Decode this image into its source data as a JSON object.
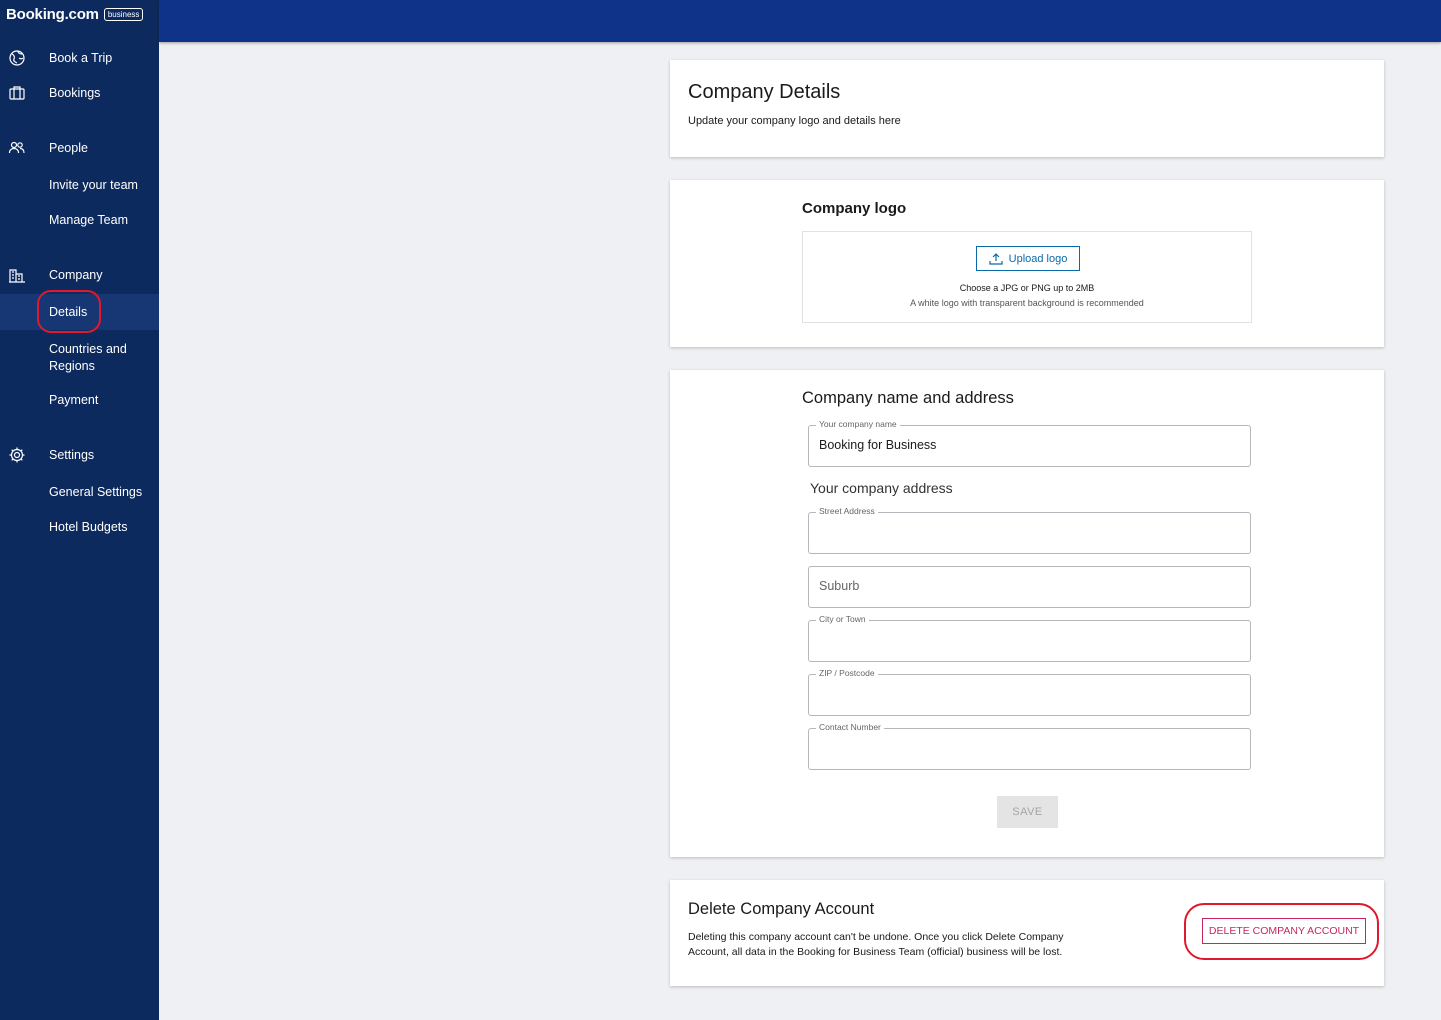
{
  "brand": {
    "name": "Booking.com",
    "badge": "business"
  },
  "sidebar": {
    "book_trip": "Book a Trip",
    "bookings": "Bookings",
    "people": "People",
    "invite_team": "Invite your team",
    "manage_team": "Manage Team",
    "company": "Company",
    "details": "Details",
    "countries_regions_line1": "Countries and",
    "countries_regions_line2": "Regions",
    "payment": "Payment",
    "settings": "Settings",
    "general_settings": "General Settings",
    "hotel_budgets": "Hotel Budgets"
  },
  "header_card": {
    "title": "Company Details",
    "subtitle": "Update your company logo and details here"
  },
  "logo_card": {
    "title": "Company logo",
    "upload_label": "Upload logo",
    "hint_formats": "Choose a JPG or PNG up to 2MB",
    "hint_recommendation": "A white logo with transparent background is recommended"
  },
  "address_card": {
    "title": "Company name and address",
    "company_name_label": "Your company name",
    "company_name_value": "Booking for Business",
    "address_heading": "Your company address",
    "street_label": "Street Address",
    "street_value": "",
    "suburb_placeholder": "Suburb",
    "city_label": "City or Town",
    "city_value": "",
    "zip_label": "ZIP / Postcode",
    "zip_value": "",
    "contact_label": "Contact Number",
    "contact_value": "",
    "save_label": "SAVE"
  },
  "delete_card": {
    "title": "Delete Company Account",
    "description_line1": "Deleting this company account can't be undone. Once you click Delete Company",
    "description_line2": "Account, all data in the Booking for Business Team (official) business will be lost.",
    "button_label": "DELETE COMPANY ACCOUNT"
  },
  "colors": {
    "sidebar_bg": "#0d2a5e",
    "topbar_bg": "#0f3388",
    "accent_blue": "#0a6aa8",
    "danger": "#c6285f",
    "annotation_red": "#e0192c"
  }
}
